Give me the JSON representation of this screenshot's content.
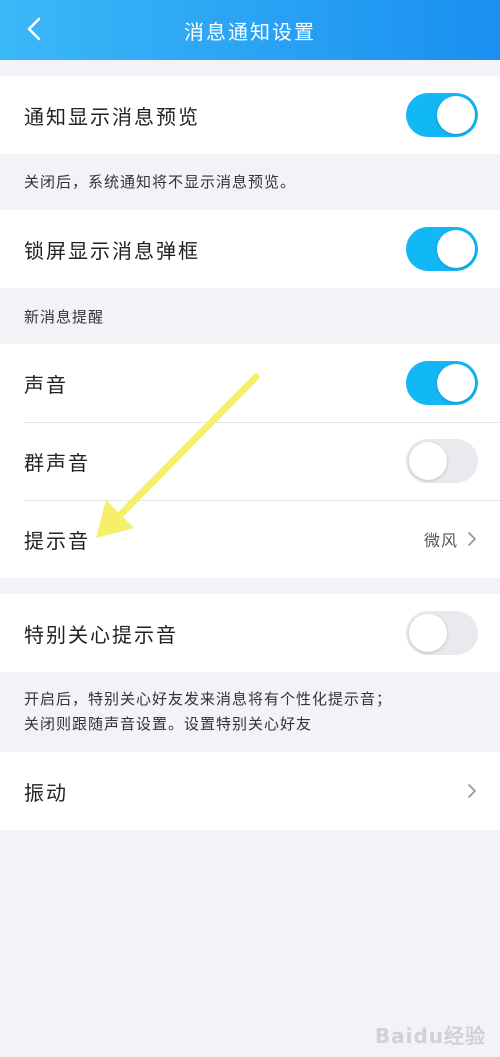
{
  "header": {
    "title": "消息通知设置",
    "background_start": "#3bb8f8",
    "background_end": "#1a8ff0",
    "back_icon": "chevron-left-icon"
  },
  "section1": {
    "preview": {
      "label": "通知显示消息预览",
      "toggle": "on"
    },
    "preview_note": "关闭后，系统通知将不显示消息预览。"
  },
  "section2": {
    "lock_popup": {
      "label": "锁屏显示消息弹框",
      "toggle": "on"
    }
  },
  "new_message": {
    "group_title": "新消息提醒",
    "sound": {
      "label": "声音",
      "toggle": "on"
    },
    "group_sound": {
      "label": "群声音",
      "toggle": "off"
    },
    "tone": {
      "label": "提示音",
      "value": "微风"
    }
  },
  "special": {
    "label": "特别关心提示音",
    "toggle": "off",
    "note_line1": "开启后，特别关心好友发来消息将有个性化提示音；",
    "note_line2": "关闭则跟随声音设置。设置特别关心好友"
  },
  "vibration": {
    "label": "振动"
  },
  "annotation": {
    "arrow_color": "#f5ef6a"
  },
  "watermark": {
    "text": "Baidu经验"
  },
  "colors": {
    "accent": "#12b7f5",
    "toggle_off": "#e9e9ee",
    "page_background": "#f2f3f7"
  }
}
